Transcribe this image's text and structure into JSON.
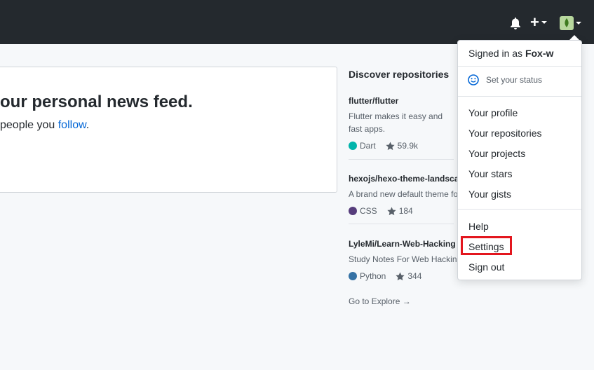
{
  "header": {
    "icons": {
      "bell": "bell-icon",
      "plus": "plus-icon",
      "avatar": "avatar-image"
    },
    "plus_label": "+"
  },
  "feed": {
    "title": "our personal news feed.",
    "subtitle_prefix": " people you ",
    "subtitle_link": "follow",
    "subtitle_suffix": "."
  },
  "discover": {
    "title": "Discover repositories",
    "repos": [
      {
        "name": "flutter/flutter",
        "desc": "Flutter makes it easy and fast apps.",
        "language": "Dart",
        "lang_color": "#00b4ab",
        "stars": "59.9k"
      },
      {
        "name": "hexojs/hexo-theme-landscap",
        "desc": "A brand new default theme fo",
        "language": "CSS",
        "lang_color": "#563d7c",
        "stars": "184"
      },
      {
        "name": "LyleMi/Learn-Web-Hacking",
        "desc": "Study Notes For Web Hacking",
        "language": "Python",
        "lang_color": "#3572a5",
        "stars": "344"
      }
    ],
    "explore": "Go to Explore →"
  },
  "dropdown": {
    "signed_in_prefix": "Signed in as ",
    "username": "Fox-w",
    "set_status": "Set your status",
    "items": [
      "Your profile",
      "Your repositories",
      "Your projects",
      "Your stars",
      "Your gists"
    ],
    "help": "Help",
    "settings": "Settings",
    "sign_out": "Sign out",
    "highlight_color": "#e3161e"
  }
}
